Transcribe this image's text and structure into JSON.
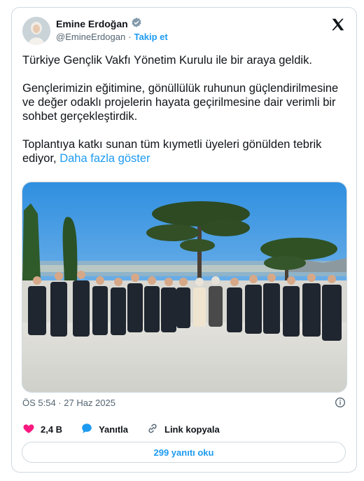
{
  "tweet": {
    "author_name": "Emine Erdoğan",
    "handle": "@EmineErdogan",
    "separator": "·",
    "follow_label": "Takip et",
    "paragraphs": [
      "Türkiye Gençlik Vakfı Yönetim Kurulu ile bir araya geldik.",
      "Gençlerimizin eğitimine, gönüllülük ruhunun güçlendirilmesine ve değer odaklı projelerin hayata geçirilmesine dair verimli bir sohbet gerçekleştirdik.",
      "Toplantıya katkı sunan tüm kıymetli üyeleri gönülden tebrik ediyor,"
    ],
    "show_more": "Daha fazla göster",
    "timestamp": "ÖS 5:54 · 27 Haz 2025",
    "likes": "2,4 B",
    "reply_label": "Yanıtla",
    "copy_link_label": "Link kopyala",
    "read_replies": "299 yanıtı oku"
  },
  "colors": {
    "accent": "#1d9bf0",
    "like": "#f91880",
    "muted": "#536471",
    "border": "#cfd9de"
  },
  "icons": [
    "verified-badge-icon",
    "x-logo-icon",
    "info-icon",
    "heart-icon",
    "reply-bubble-icon",
    "link-icon"
  ]
}
